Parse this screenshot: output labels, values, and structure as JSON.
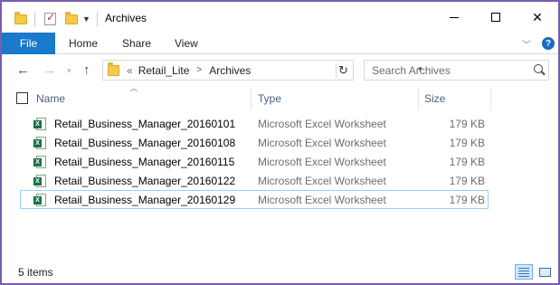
{
  "window": {
    "title": "Archives",
    "controls": {
      "minimize": "minimize",
      "maximize": "maximize",
      "close": "✕"
    }
  },
  "ribbon": {
    "tabs": [
      {
        "label": "File",
        "active": true
      },
      {
        "label": "Home"
      },
      {
        "label": "Share"
      },
      {
        "label": "View"
      }
    ],
    "help": "?"
  },
  "nav": {
    "back": "←",
    "forward": "→",
    "up": "↑",
    "breadcrumb": {
      "overflow": "«",
      "items": [
        "Retail_Lite",
        "Archives"
      ],
      "separator": ">"
    },
    "refresh": "↻",
    "search_placeholder": "Search Archives"
  },
  "columns": {
    "name": "Name",
    "type": "Type",
    "size": "Size"
  },
  "files": [
    {
      "name": "Retail_Business_Manager_20160101",
      "type": "Microsoft Excel Worksheet",
      "size": "179 KB",
      "selected": false
    },
    {
      "name": "Retail_Business_Manager_20160108",
      "type": "Microsoft Excel Worksheet",
      "size": "179 KB",
      "selected": false
    },
    {
      "name": "Retail_Business_Manager_20160115",
      "type": "Microsoft Excel Worksheet",
      "size": "179 KB",
      "selected": false
    },
    {
      "name": "Retail_Business_Manager_20160122",
      "type": "Microsoft Excel Worksheet",
      "size": "179 KB",
      "selected": false
    },
    {
      "name": "Retail_Business_Manager_20160129",
      "type": "Microsoft Excel Worksheet",
      "size": "179 KB",
      "selected": true
    }
  ],
  "status": {
    "item_count": "5 items",
    "view_mode": "details"
  },
  "colors": {
    "file_tab": "#1979ca",
    "header_text": "#4c607a",
    "selection_border": "#99d1ff",
    "window_border": "#7a5cae"
  },
  "icons": {
    "file": "excel-icon",
    "folder": "folder-icon"
  }
}
